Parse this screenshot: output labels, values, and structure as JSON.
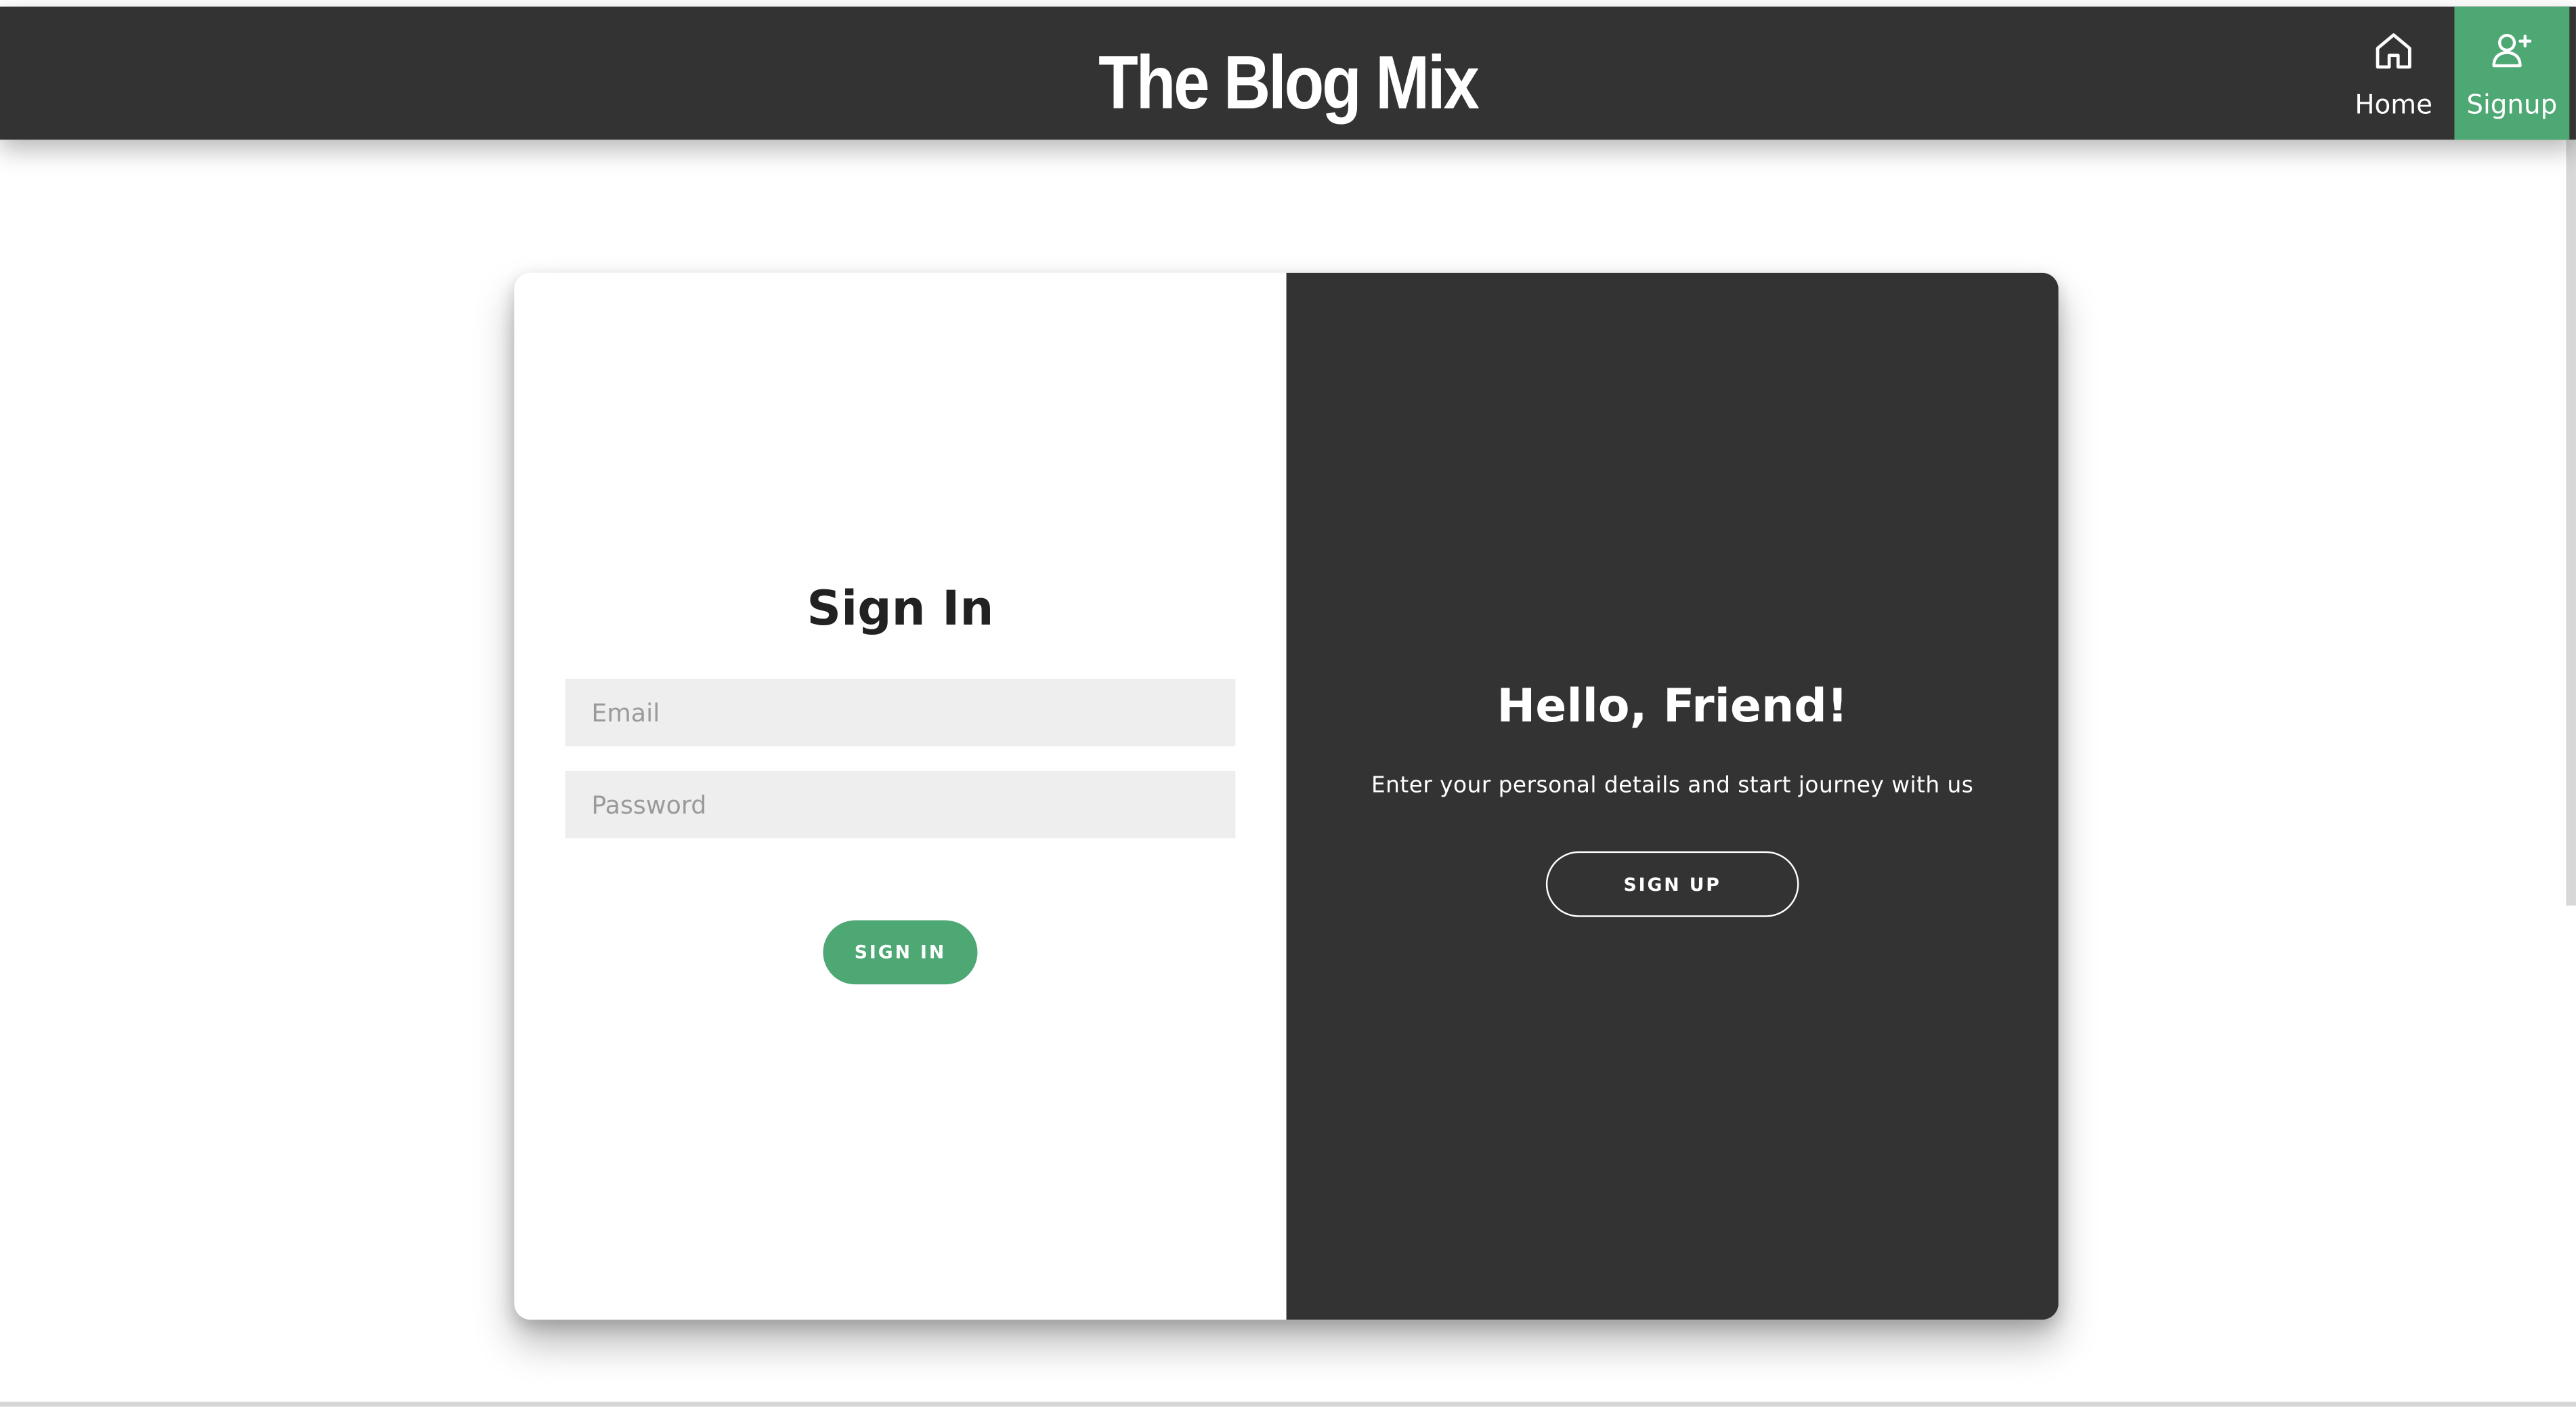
{
  "header": {
    "brand": "The Blog Mix",
    "nav": [
      {
        "label": "Home",
        "icon": "home-icon"
      },
      {
        "label": "Signup",
        "icon": "user-plus-icon",
        "active": true
      }
    ]
  },
  "sign_in": {
    "title": "Sign In",
    "email_placeholder": "Email",
    "email_value": "",
    "password_placeholder": "Password",
    "password_value": "",
    "button_label": "SIGN IN"
  },
  "overlay": {
    "title": "Hello, Friend!",
    "text": "Enter your personal details and start journey with us",
    "button_label": "SIGN UP"
  },
  "colors": {
    "dark": "#333333",
    "accent": "#4ea874",
    "input_bg": "#eeeeee",
    "background": "#ffffff"
  }
}
